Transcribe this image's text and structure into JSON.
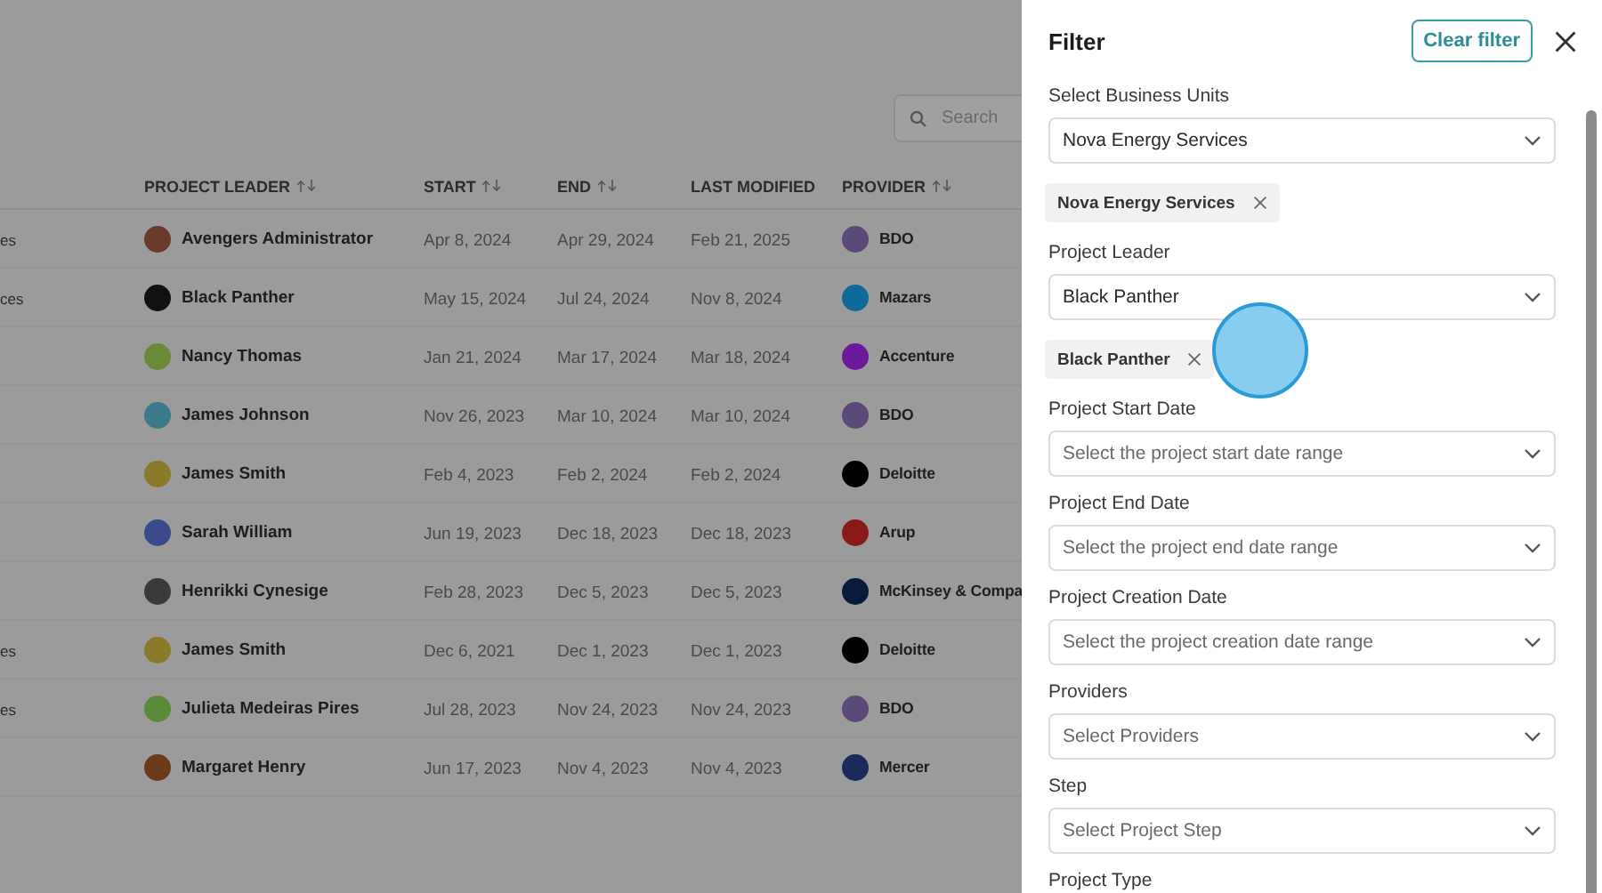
{
  "search": {
    "placeholder": "Search"
  },
  "table": {
    "columns": [
      {
        "label": "PROJECT LEADER",
        "sortable": true
      },
      {
        "label": "START",
        "sortable": true
      },
      {
        "label": "END",
        "sortable": true
      },
      {
        "label": "LAST MODIFIED",
        "sortable": false
      },
      {
        "label": "PROVIDER",
        "sortable": true
      }
    ],
    "rows": [
      {
        "column_1": "es",
        "leader": {
          "name": "Avengers Administrator",
          "color": "#6a3a2a"
        },
        "start": "Apr 8, 2024",
        "end": "Apr 29, 2024",
        "modified": "Feb 21, 2025",
        "provider": {
          "name": "BDO",
          "color": "#5a4a7a"
        }
      },
      {
        "column_1": "ces",
        "leader": {
          "name": "Black Panther",
          "color": "#111111"
        },
        "start": "May 15, 2024",
        "end": "Jul 24, 2024",
        "modified": "Nov 8, 2024",
        "provider": {
          "name": "Mazars",
          "color": "#0f6a9a"
        }
      },
      {
        "leader": {
          "name": "Nancy Thomas",
          "color": "#6a8a3a"
        },
        "start": "Jan 21, 2024",
        "end": "Mar 17, 2024",
        "modified": "Mar 18, 2024",
        "provider": {
          "name": "Accenture",
          "color": "#6a1a9a"
        }
      },
      {
        "leader": {
          "name": "James Johnson",
          "color": "#3a7a8a"
        },
        "start": "Nov 26, 2023",
        "end": "Mar 10, 2024",
        "modified": "Mar 10, 2024",
        "provider": {
          "name": "BDO",
          "color": "#5a4a7a"
        }
      },
      {
        "leader": {
          "name": "James Smith",
          "color": "#8a7a2a"
        },
        "start": "Feb 4, 2023",
        "end": "Feb 2, 2024",
        "modified": "Feb 2, 2024",
        "provider": {
          "name": "Deloitte",
          "color": "#000000"
        }
      },
      {
        "leader": {
          "name": "Sarah William",
          "color": "#3a4a8a"
        },
        "start": "Jun 19, 2023",
        "end": "Dec 18, 2023",
        "modified": "Dec 18, 2023",
        "provider": {
          "name": "Arup",
          "color": "#8a1a1a"
        }
      },
      {
        "leader": {
          "name": "Henrikki Cynesige",
          "color": "#3a3a3a"
        },
        "start": "Feb 28, 2023",
        "end": "Dec 5, 2023",
        "modified": "Dec 5, 2023",
        "provider": {
          "name": "McKinsey & Compa",
          "color": "#0a1a3a"
        }
      },
      {
        "column_1": "es",
        "leader": {
          "name": "James Smith",
          "color": "#8a7a2a"
        },
        "start": "Dec 6, 2021",
        "end": "Dec 1, 2023",
        "modified": "Dec 1, 2023",
        "provider": {
          "name": "Deloitte",
          "color": "#000000"
        }
      },
      {
        "column_1": "es",
        "leader": {
          "name": "Julieta Medeiras Pires",
          "color": "#5a8a3a"
        },
        "start": "Jul 28, 2023",
        "end": "Nov 24, 2023",
        "modified": "Nov 24, 2023",
        "provider": {
          "name": "BDO",
          "color": "#5a4a7a"
        }
      },
      {
        "leader": {
          "name": "Margaret Henry",
          "color": "#6a3a1a"
        },
        "start": "Jun 17, 2023",
        "end": "Nov 4, 2023",
        "modified": "Nov 4, 2023",
        "provider": {
          "name": "Mercer",
          "color": "#1a2a5a"
        }
      }
    ]
  },
  "filter": {
    "title": "Filter",
    "clear_button": "Clear filter",
    "fields": [
      {
        "label": "Select Business Units",
        "value": "Nova Energy Services",
        "tags": [
          "Nova Energy Services"
        ]
      },
      {
        "label": "Project Leader",
        "value": "Black Panther",
        "tags": [
          "Black Panther"
        ]
      },
      {
        "label": "Project Start Date",
        "placeholder": "Select the project start date range"
      },
      {
        "label": "Project End Date",
        "placeholder": "Select the project end date range"
      },
      {
        "label": "Project Creation Date",
        "placeholder": "Select the project creation date range"
      },
      {
        "label": "Providers",
        "placeholder": "Select Providers"
      },
      {
        "label": "Step",
        "placeholder": "Select Project Step"
      },
      {
        "label": "Project Type"
      }
    ]
  }
}
